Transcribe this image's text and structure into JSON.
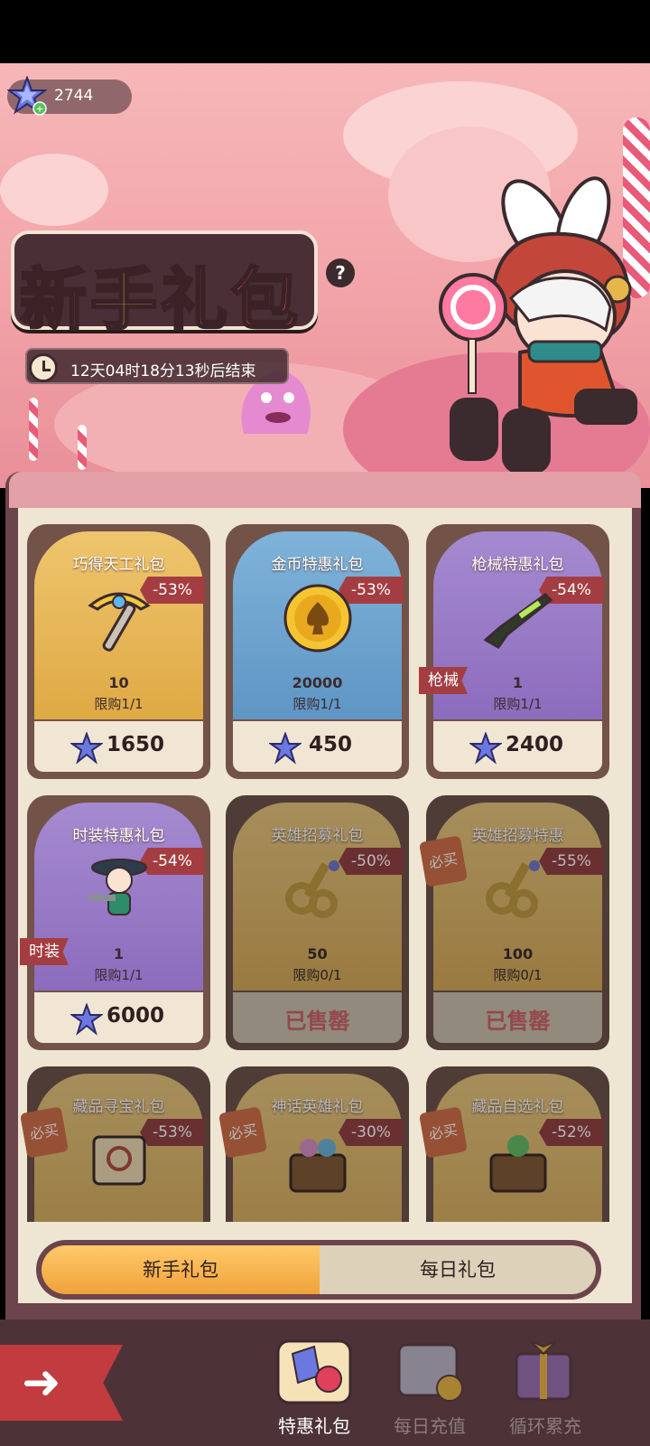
{
  "header": {
    "currency_amount": "2744",
    "currency_icon": "star-gem-icon",
    "title_part1": "新手",
    "title_part2": "礼包",
    "timer_text": "12天04时18分13秒后结束"
  },
  "packs": [
    {
      "name": "巧得天工礼包",
      "discount": "-53%",
      "quantity": "10",
      "limit": "限购1/1",
      "price": "1650",
      "icon": "pickaxe-icon",
      "theme": "gold"
    },
    {
      "name": "金币特惠礼包",
      "discount": "-53%",
      "quantity": "20000",
      "limit": "限购1/1",
      "price": "450",
      "icon": "gold-coin-icon",
      "theme": "blue"
    },
    {
      "name": "枪械特惠礼包",
      "discount": "-54%",
      "quantity": "1",
      "limit": "限购1/1",
      "price": "2400",
      "icon": "rifle-icon",
      "theme": "purple",
      "tag": "枪械"
    },
    {
      "name": "时装特惠礼包",
      "discount": "-54%",
      "quantity": "1",
      "limit": "限购1/1",
      "price": "6000",
      "icon": "hero-costume-icon",
      "theme": "purple",
      "tag": "时装"
    },
    {
      "name": "英雄招募礼包",
      "discount": "-50%",
      "quantity": "50",
      "limit": "限购0/1",
      "status": "已售罄",
      "icon": "golden-key-icon",
      "theme": "gold"
    },
    {
      "name": "英雄招募特惠",
      "discount": "-55%",
      "quantity": "100",
      "limit": "限购0/1",
      "status": "已售罄",
      "icon": "golden-key-icon",
      "theme": "gold",
      "badge": "必买"
    },
    {
      "name": "藏品寻宝礼包",
      "discount": "-53%",
      "icon": "treasure-map-icon",
      "theme": "gold",
      "badge": "必买"
    },
    {
      "name": "神话英雄礼包",
      "discount": "-30%",
      "icon": "treasure-chest-icon",
      "theme": "gold",
      "badge": "必买"
    },
    {
      "name": "藏品自选礼包",
      "discount": "-52%",
      "icon": "treasure-chest-icon",
      "theme": "gold",
      "badge": "必买"
    }
  ],
  "tabs": {
    "active": "新手礼包",
    "inactive": "每日礼包"
  },
  "bottom_nav": [
    {
      "label": "特惠礼包",
      "icon": "gift-pack-icon",
      "active": true
    },
    {
      "label": "每日充值",
      "icon": "daily-recharge-icon",
      "active": false
    },
    {
      "label": "循环累充",
      "icon": "cumulative-recharge-icon",
      "active": false
    }
  ],
  "colors": {
    "accent_red": "#a43d41",
    "gold_tab": "#f0a23a",
    "banner_pink": "#f3a7ab"
  }
}
